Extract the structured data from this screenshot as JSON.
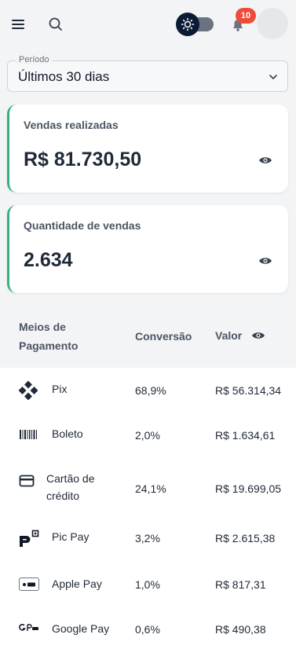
{
  "header": {
    "notification_count": "10"
  },
  "period": {
    "label": "Período",
    "value": "Últimos 30 dias"
  },
  "cards": [
    {
      "label": "Vendas realizadas",
      "value": "R$ 81.730,50"
    },
    {
      "label": "Quantidade de vendas",
      "value": "2.634"
    }
  ],
  "table": {
    "headers": {
      "method_line1": "Meios de",
      "method_line2": "Pagamento",
      "conversion": "Conversão",
      "value": "Valor"
    },
    "rows": [
      {
        "icon": "pix-icon",
        "name": "Pix",
        "conversion": "68,9%",
        "value": "R$ 56.314,34"
      },
      {
        "icon": "barcode-icon",
        "name": "Boleto",
        "conversion": "2,0%",
        "value": "R$ 1.634,61"
      },
      {
        "icon": "credit-card-icon",
        "name_line1": "Cartão de",
        "name_line2": "crédito",
        "conversion": "24,1%",
        "value": "R$ 19.699,05"
      },
      {
        "icon": "picpay-icon",
        "name": "Pic Pay",
        "conversion": "3,2%",
        "value": "R$ 2.615,38"
      },
      {
        "icon": "apple-pay-icon",
        "name": "Apple Pay",
        "conversion": "1,0%",
        "value": "R$ 817,31"
      },
      {
        "icon": "google-pay-icon",
        "name": "Google Pay",
        "conversion": "0,6%",
        "value": "R$ 490,38"
      }
    ]
  },
  "colors": {
    "accent": "#34b27b",
    "badge": "#ef4b3a",
    "theme_knob": "#0b1a35"
  }
}
